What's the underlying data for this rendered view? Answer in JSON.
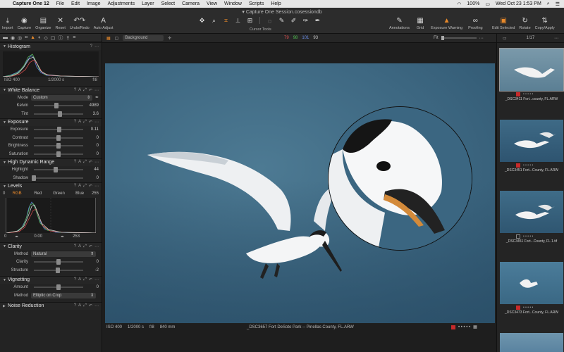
{
  "menubar": {
    "app_name": "Capture One 12",
    "menus": [
      "File",
      "Edit",
      "Image",
      "Adjustments",
      "Layer",
      "Select",
      "Camera",
      "View",
      "Window",
      "Scripts",
      "Help"
    ],
    "battery": "100%",
    "clock": "Wed Oct 23  1:53 PM"
  },
  "toolbar": {
    "document_title": "Capture One Session.cosessiondb",
    "left_buttons": [
      {
        "label": "Import",
        "icon": "import-icon"
      },
      {
        "label": "Capture",
        "icon": "camera-icon"
      },
      {
        "label": "Organize",
        "icon": "organize-icon"
      },
      {
        "label": "Reset",
        "icon": "reset-icon"
      },
      {
        "label": "Undo/Redo",
        "icon": "undo-redo-icon"
      },
      {
        "label": "Auto Adjust",
        "icon": "auto-adjust-icon"
      }
    ],
    "cursor_tools_label": "Cursor Tools",
    "right_buttons": [
      {
        "label": "Annotations",
        "icon": "annotations-icon"
      },
      {
        "label": "Grid",
        "icon": "grid-icon"
      },
      {
        "label": "Exposure Warning",
        "icon": "warning-icon"
      },
      {
        "label": "Proofing",
        "icon": "proofing-icon"
      },
      {
        "label": "Edit Selected",
        "icon": "edit-selected-icon"
      },
      {
        "label": "Rotate",
        "icon": "rotate-icon"
      },
      {
        "label": "Copy/Apply",
        "icon": "copy-apply-icon"
      }
    ]
  },
  "histogram": {
    "title": "Histogram",
    "iso": "ISO 400",
    "shutter": "1/2000 s",
    "aperture": "f/8"
  },
  "white_balance": {
    "title": "White Balance",
    "mode_label": "Mode",
    "mode_value": "Custom",
    "kelvin_label": "Kelvin",
    "kelvin_value": "4989",
    "kelvin_level": 0.45,
    "tint_label": "Tint",
    "tint_value": "3.6",
    "tint_level": 0.53
  },
  "exposure": {
    "title": "Exposure",
    "rows": [
      {
        "label": "Exposure",
        "value": "0.11",
        "level": 0.52
      },
      {
        "label": "Contrast",
        "value": "0",
        "level": 0.5
      },
      {
        "label": "Brightness",
        "value": "0",
        "level": 0.5
      },
      {
        "label": "Saturation",
        "value": "0",
        "level": 0.5
      }
    ]
  },
  "hdr": {
    "title": "High Dynamic Range",
    "rows": [
      {
        "label": "Highlight",
        "value": "44",
        "level": 0.44
      },
      {
        "label": "Shadow",
        "value": "0",
        "level": 0.0
      }
    ]
  },
  "levels": {
    "title": "Levels",
    "input_low": "0",
    "input_high": "255",
    "channels": [
      "RGB",
      "Red",
      "Green",
      "Blue"
    ],
    "output_low": "0",
    "mid": "0.00",
    "output_high": "253"
  },
  "clarity": {
    "title": "Clarity",
    "method_label": "Method",
    "method_value": "Natural",
    "rows": [
      {
        "label": "Clarity",
        "value": "0",
        "level": 0.5
      },
      {
        "label": "Structure",
        "value": "-2",
        "level": 0.49
      }
    ]
  },
  "vignetting": {
    "title": "Vignetting",
    "amount_label": "Amount",
    "amount_value": "0",
    "amount_level": 0.5,
    "method_label": "Method",
    "method_value": "Elliptic on Crop"
  },
  "noise_reduction": {
    "title": "Noise Reduction"
  },
  "viewer_bar": {
    "background": "Background",
    "rgb": [
      "79",
      "98",
      "101",
      "93"
    ],
    "fit": "Fit"
  },
  "viewer_footer": {
    "iso": "ISO 400",
    "shutter": "1/2000 s",
    "aperture": "f/8",
    "focal": "840 mm",
    "filename": "_DSC3657 Fort DeSoto Park -- Pinellas County, FL.ARW"
  },
  "browser": {
    "counter": "1/17",
    "thumbnails": [
      {
        "caption": "_DSC3411 Fort...county, FL.ARW",
        "color_tag": "#c72a2a",
        "selected": true
      },
      {
        "caption": "_DSC3451 Fort...County, FL.ARW",
        "color_tag": "#c72a2a",
        "selected": false
      },
      {
        "caption": "_DSC3451 Fort...County, FL 1.tif",
        "color_tag": "none",
        "selected": false
      },
      {
        "caption": "_DSC3473 Fort...County, FL.ARW",
        "color_tag": "#c72a2a",
        "selected": false
      }
    ]
  },
  "colors": {
    "accent": "#e8892a",
    "red_tag": "#c72a2a",
    "panel": "#232323"
  }
}
